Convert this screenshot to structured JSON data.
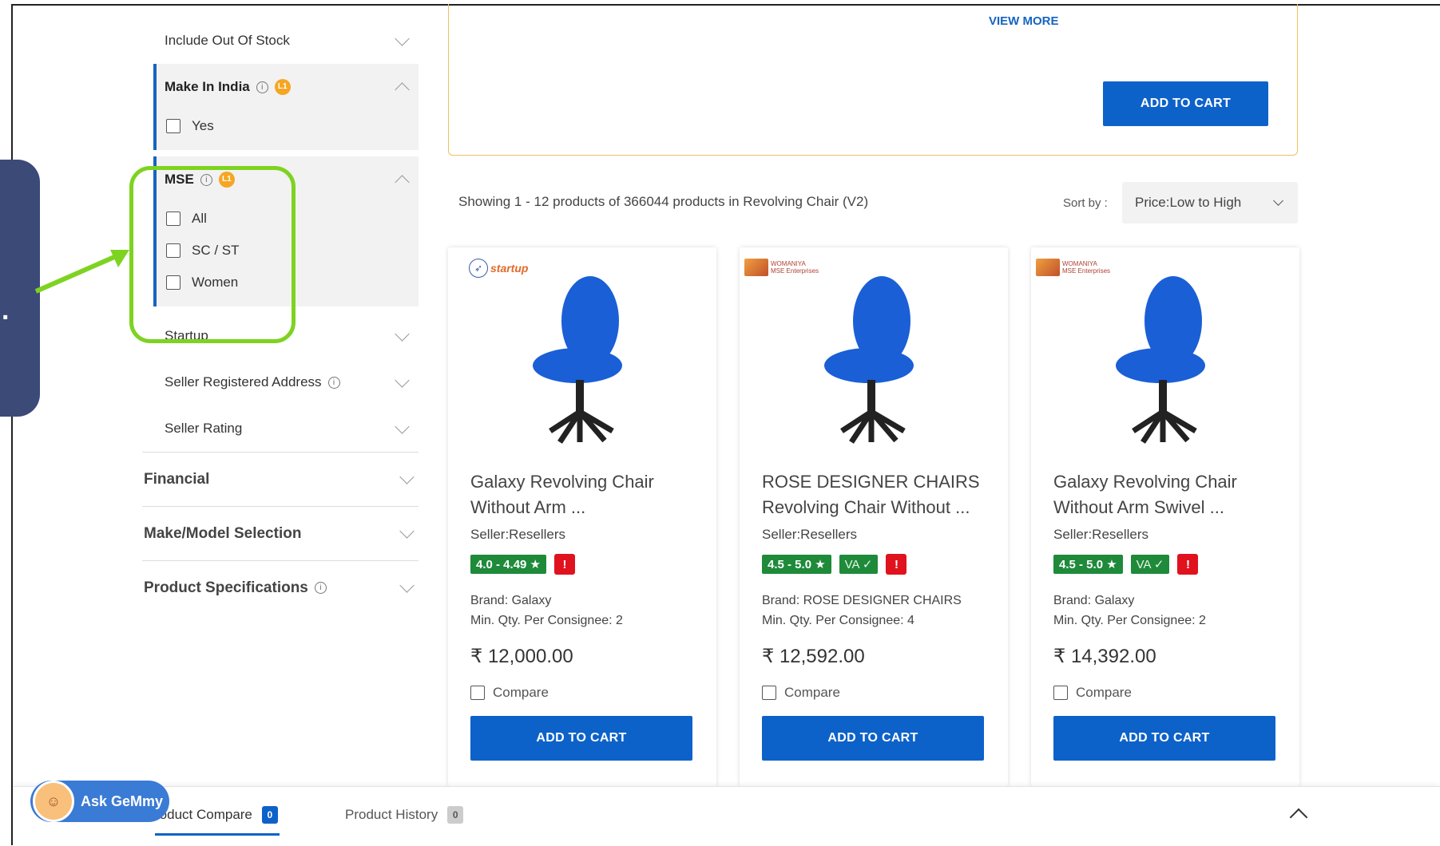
{
  "sidebar": {
    "include_out_of_stock": "Include Out Of Stock",
    "make_in_india": {
      "label": "Make In India",
      "badge": "L1",
      "options": [
        "Yes"
      ]
    },
    "mse": {
      "label": "MSE",
      "badge": "L1",
      "options": [
        "All",
        "SC / ST",
        "Women"
      ]
    },
    "startup": "Startup",
    "seller_registered_address": "Seller Registered Address",
    "seller_rating": "Seller Rating",
    "financial": "Financial",
    "make_model_selection": "Make/Model Selection",
    "product_specifications": "Product Specifications"
  },
  "banner": {
    "view_more": "VIEW MORE",
    "add_to_cart": "ADD TO CART"
  },
  "results": {
    "showing": "Showing 1 - 12 products of 366044 products in Revolving Chair (V2)",
    "sort_label": "Sort by :",
    "sort_value": "Price:Low to High"
  },
  "products": [
    {
      "badge": "startup",
      "title": "Galaxy Revolving Chair Without Arm ...",
      "seller": "Seller:Resellers",
      "rating": "4.0 - 4.49 ★",
      "va": "",
      "brand": "Brand: Galaxy",
      "min_qty": "Min. Qty. Per Consignee: 2",
      "price": "₹ 12,000.00",
      "compare": "Compare",
      "add_to_cart": "ADD TO CART"
    },
    {
      "badge": "mse",
      "title": "ROSE DESIGNER CHAIRS Revolving Chair Without ...",
      "seller": "Seller:Resellers",
      "rating": "4.5 - 5.0 ★",
      "va": "VA ✓",
      "brand": "Brand: ROSE DESIGNER CHAIRS",
      "min_qty": "Min. Qty. Per Consignee: 4",
      "price": "₹ 12,592.00",
      "compare": "Compare",
      "add_to_cart": "ADD TO CART"
    },
    {
      "badge": "mse",
      "title": "Galaxy Revolving Chair Without Arm Swivel ...",
      "seller": "Seller:Resellers",
      "rating": "4.5 - 5.0 ★",
      "va": "VA ✓",
      "brand": "Brand: Galaxy",
      "min_qty": "Min. Qty. Per Consignee: 2",
      "price": "₹ 14,392.00",
      "compare": "Compare",
      "add_to_cart": "ADD TO CART"
    }
  ],
  "bottom_bar": {
    "compare_tab": "roduct Compare",
    "compare_count": "0",
    "history_tab": "Product History",
    "history_count": "0",
    "assistant": "Ask GeMmy"
  },
  "colors": {
    "primary": "#0d62c9",
    "highlight": "#7ed321",
    "rating_green": "#1e8a3a",
    "warning_red": "#e0121e",
    "callout": "#3c4a78"
  }
}
